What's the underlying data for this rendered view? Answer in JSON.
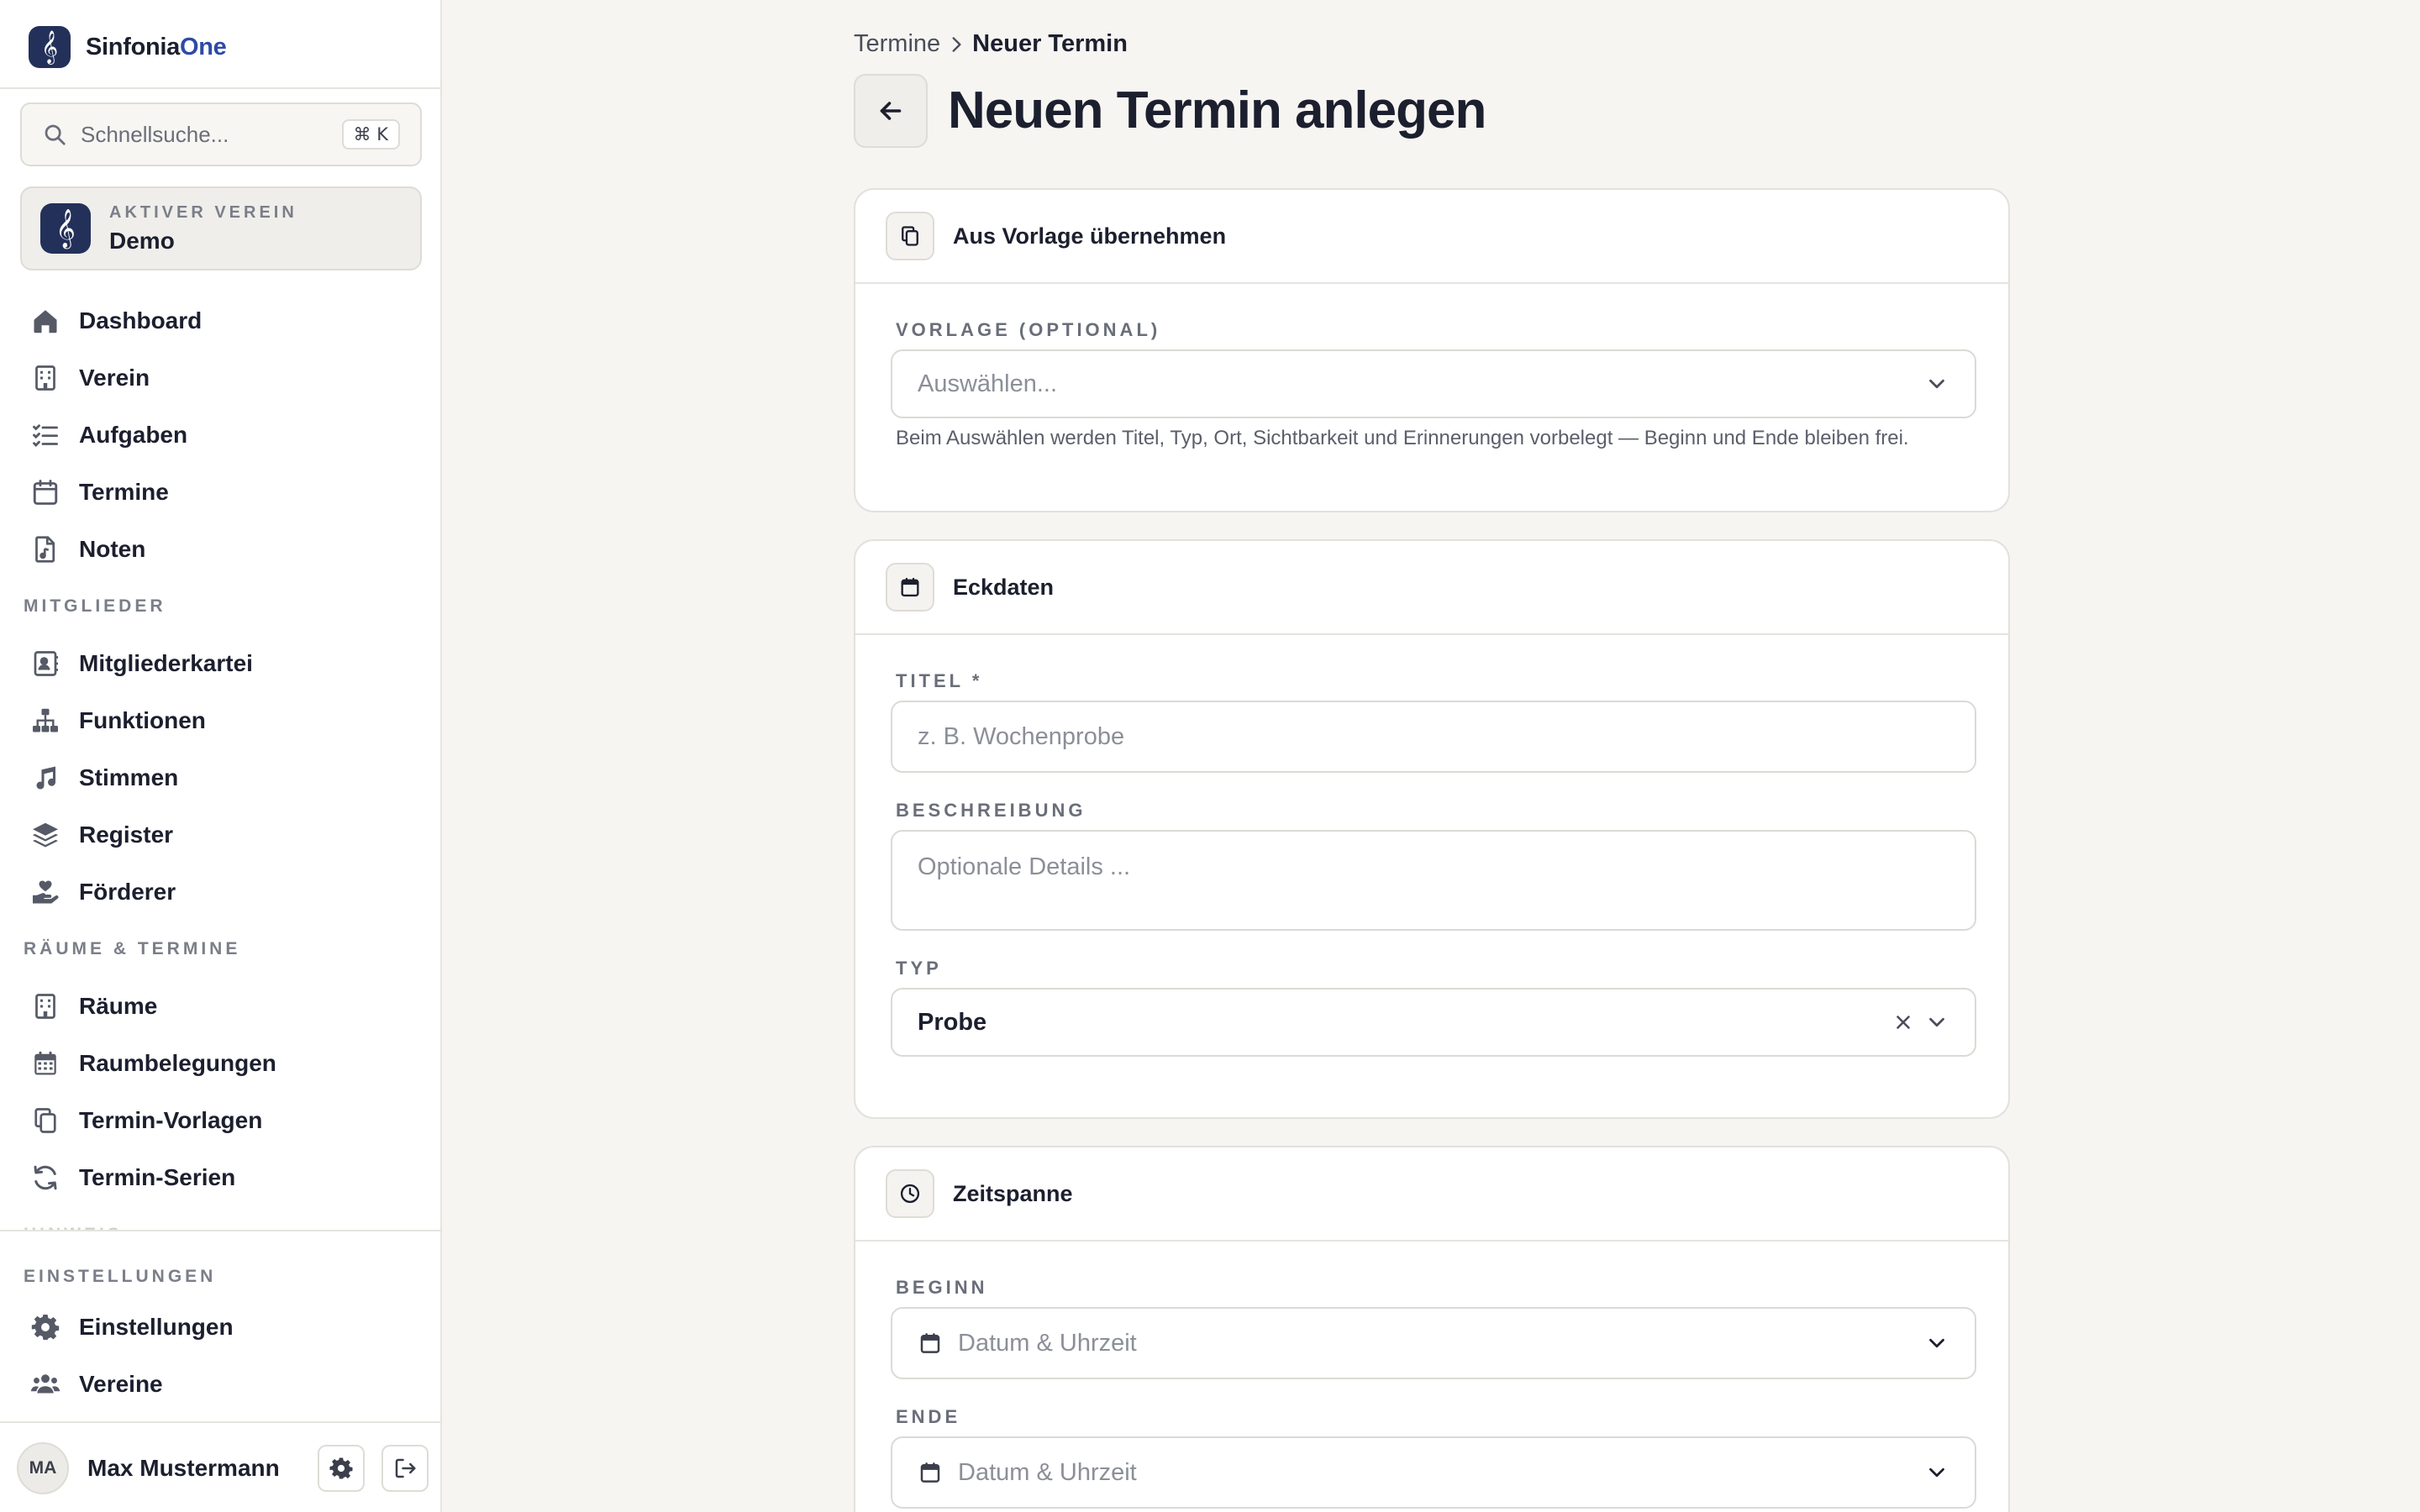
{
  "app": {
    "name_main": "Sinfonia",
    "name_accent": "One"
  },
  "sidebar": {
    "search_placeholder": "Schnellsuche...",
    "search_shortcut": "⌘ K",
    "club": {
      "kicker": "AKTIVER VEREIN",
      "name": "Demo"
    },
    "main_items": [
      {
        "label": "Dashboard",
        "icon": "home-icon"
      },
      {
        "label": "Verein",
        "icon": "building-icon"
      },
      {
        "label": "Aufgaben",
        "icon": "checklist-icon"
      },
      {
        "label": "Termine",
        "icon": "calendar-icon"
      },
      {
        "label": "Noten",
        "icon": "sheet-music-file-icon"
      }
    ],
    "section_members": "MITGLIEDER",
    "member_items": [
      {
        "label": "Mitgliederkartei",
        "icon": "contact-card-icon"
      },
      {
        "label": "Funktionen",
        "icon": "org-chart-icon"
      },
      {
        "label": "Stimmen",
        "icon": "music-note-icon"
      },
      {
        "label": "Register",
        "icon": "layers-icon"
      },
      {
        "label": "Förderer",
        "icon": "hand-heart-icon"
      }
    ],
    "section_rooms": "RÄUME & TERMINE",
    "room_items": [
      {
        "label": "Räume",
        "icon": "building-icon"
      },
      {
        "label": "Raumbelegungen",
        "icon": "calendar-grid-icon"
      },
      {
        "label": "Termin-Vorlagen",
        "icon": "copy-icon"
      },
      {
        "label": "Termin-Serien",
        "icon": "refresh-icon"
      }
    ],
    "section_settings": "EINSTELLUNGEN",
    "settings_items": [
      {
        "label": "Einstellungen",
        "icon": "gear-icon"
      },
      {
        "label": "Vereine",
        "icon": "users-icon"
      }
    ],
    "user": {
      "initials": "MA",
      "name": "Max Mustermann"
    }
  },
  "breadcrumb": {
    "parent": "Termine",
    "current": "Neuer Termin"
  },
  "page_title": "Neuen Termin anlegen",
  "cards": {
    "template": {
      "title": "Aus Vorlage übernehmen",
      "label": "VORLAGE (OPTIONAL)",
      "placeholder": "Auswählen...",
      "hint": "Beim Auswählen werden Titel, Typ, Ort, Sichtbarkeit und Erinnerungen vorbelegt — Beginn und Ende bleiben frei."
    },
    "basics": {
      "title": "Eckdaten",
      "title_label": "TITEL *",
      "title_placeholder": "z. B. Wochenprobe",
      "description_label": "BESCHREIBUNG",
      "description_placeholder": "Optionale Details ...",
      "type_label": "TYP",
      "type_value": "Probe"
    },
    "timespan": {
      "title": "Zeitspanne",
      "start_label": "BEGINN",
      "start_placeholder": "Datum & Uhrzeit",
      "end_label": "ENDE",
      "end_placeholder": "Datum & Uhrzeit"
    }
  }
}
